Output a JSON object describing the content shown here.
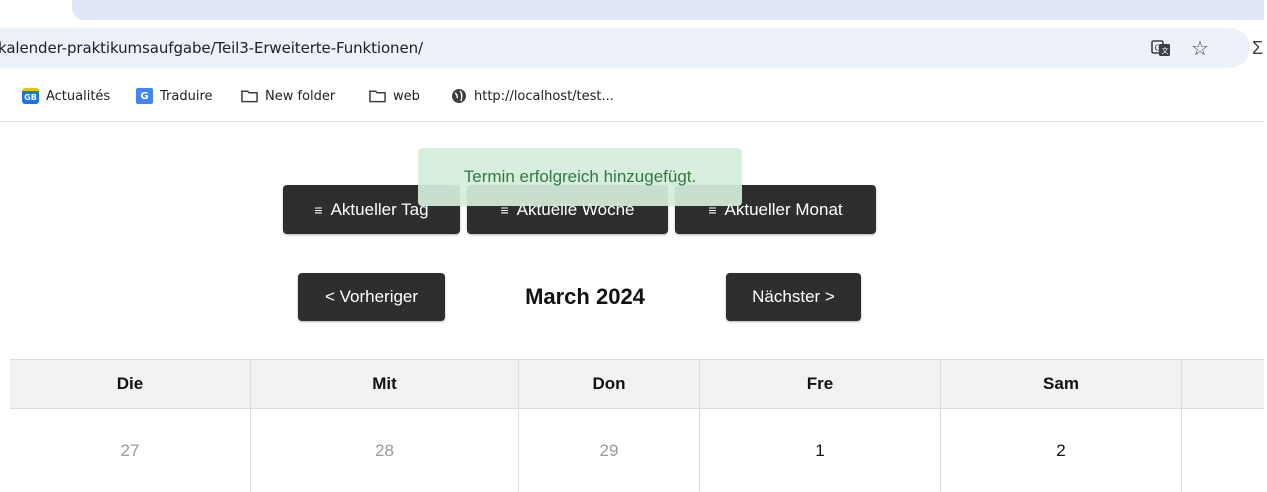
{
  "browser": {
    "url": "kalender-praktikumsaufgabe/Teil3-Erweiterte-Funktionen/",
    "bookmarks": [
      {
        "label": "Actualités",
        "icon": "google-news-icon"
      },
      {
        "label": "Traduire",
        "icon": "google-translate-icon"
      },
      {
        "label": "New folder",
        "icon": "folder-icon"
      },
      {
        "label": "web",
        "icon": "folder-icon"
      },
      {
        "label": "http://localhost/test...",
        "icon": "globe-icon"
      }
    ]
  },
  "toast": {
    "message": "Termin erfolgreich hinzugefügt."
  },
  "view_buttons": [
    {
      "label": "Aktueller Tag",
      "icon": "filter-icon"
    },
    {
      "label": "Aktuelle Woche",
      "icon": "filter-icon"
    },
    {
      "label": "Aktueller Monat",
      "icon": "filter-icon"
    }
  ],
  "nav": {
    "prev_label": "< Vorheriger",
    "next_label": "Nächster >",
    "month_title": "March 2024"
  },
  "calendar": {
    "weekdays": [
      "Die",
      "Mit",
      "Don",
      "Fre",
      "Sam"
    ],
    "first_row": [
      {
        "day": "27",
        "in_month": false
      },
      {
        "day": "28",
        "in_month": false
      },
      {
        "day": "29",
        "in_month": false
      },
      {
        "day": "1",
        "in_month": true
      },
      {
        "day": "2",
        "in_month": true
      }
    ]
  },
  "colors": {
    "button_bg": "#2e2e2e",
    "toast_bg": "#d4edda",
    "toast_text": "#237133",
    "header_bg": "#f2f2f2"
  }
}
